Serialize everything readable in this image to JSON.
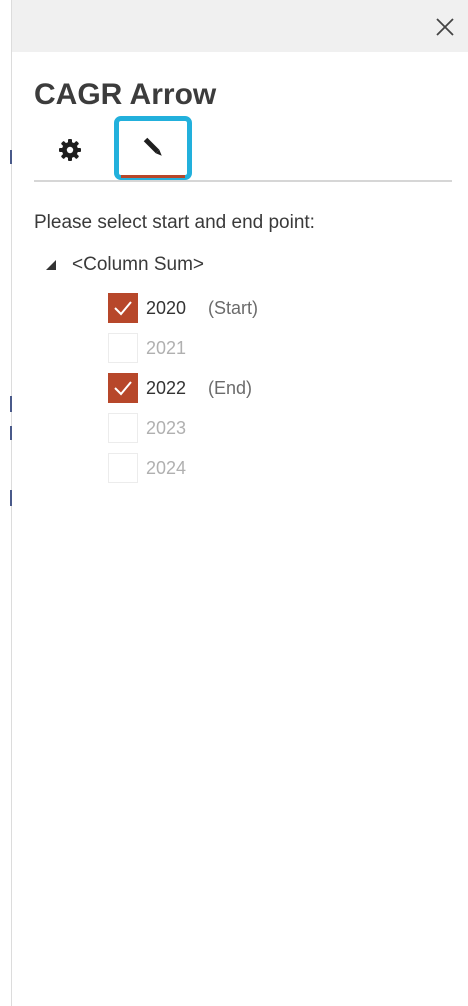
{
  "window": {
    "close_icon": "close-icon"
  },
  "pane": {
    "title": "CAGR Arrow"
  },
  "tabs": [
    {
      "icon": "gear-icon",
      "selected": false
    },
    {
      "icon": "pencil-icon",
      "selected": true
    }
  ],
  "instruction": "Please select start and end point:",
  "tree": {
    "root_label": "<Column Sum>",
    "expanded": true,
    "items": [
      {
        "year": "2020",
        "checked": true,
        "tag": "(Start)"
      },
      {
        "year": "2021",
        "checked": false,
        "tag": ""
      },
      {
        "year": "2022",
        "checked": true,
        "tag": "(End)"
      },
      {
        "year": "2023",
        "checked": false,
        "tag": ""
      },
      {
        "year": "2024",
        "checked": false,
        "tag": ""
      }
    ]
  },
  "colors": {
    "accent": "#b7472a",
    "highlight": "#22b0dc",
    "titlebar_bg": "#f0f0f0"
  }
}
